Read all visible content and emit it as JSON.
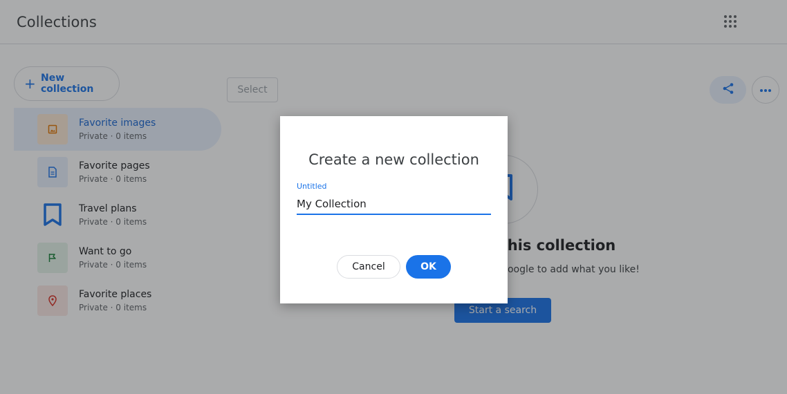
{
  "header": {
    "title": "Collections",
    "apps_icon": "apps-grid-icon"
  },
  "sidebar": {
    "new_collection_label": "New collection",
    "items": [
      {
        "name": "Favorite images",
        "meta": "Private · 0 items",
        "icon": "image-icon",
        "selected": true,
        "thumb_color": "#fce8d5",
        "icon_color": "#e37400"
      },
      {
        "name": "Favorite pages",
        "meta": "Private · 0 items",
        "icon": "page-icon",
        "selected": false,
        "thumb_color": "#e8f0fe",
        "icon_color": "#1a73e8"
      },
      {
        "name": "Travel plans",
        "meta": "Private · 0 items",
        "icon": "bookmark-icon",
        "selected": false,
        "thumb_color": "#ffffff",
        "icon_color": "#1a73e8"
      },
      {
        "name": "Want to go",
        "meta": "Private · 0 items",
        "icon": "flag-icon",
        "selected": false,
        "thumb_color": "#e6f4ea",
        "icon_color": "#188038"
      },
      {
        "name": "Favorite places",
        "meta": "Private · 0 items",
        "icon": "location-pin-icon",
        "selected": false,
        "thumb_color": "#fce8e6",
        "icon_color": "#d93025"
      }
    ]
  },
  "main": {
    "select_label": "Select",
    "empty_title": "his collection",
    "empty_subtitle": "Google to add what you like!",
    "start_search_label": "Start a search"
  },
  "dialog": {
    "title": "Create a new collection",
    "field_label": "Untitled",
    "field_value": "My Collection",
    "cancel_label": "Cancel",
    "ok_label": "OK"
  },
  "colors": {
    "accent": "#1a73e8",
    "selected_bg": "#e8f0fe"
  }
}
